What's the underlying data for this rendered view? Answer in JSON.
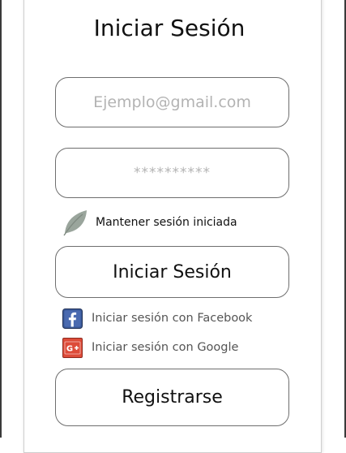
{
  "login": {
    "title": "Iniciar Sesión",
    "email_placeholder": "Ejemplo@gmail.com",
    "password_placeholder": "**********",
    "keep_session_label": "Mantener sesión iniciada",
    "login_button": "Iniciar Sesión",
    "facebook_label": "Iniciar sesión con Facebook",
    "google_label": "Iniciar sesión con Google",
    "register_button": "Registrarse"
  },
  "icons": {
    "keep_session": "leaf-icon",
    "facebook": "facebook-icon",
    "google": "google-plus-icon"
  },
  "colors": {
    "leaf": "#9aa59c",
    "facebook": "#3b5998",
    "google": "#dd4b39"
  }
}
